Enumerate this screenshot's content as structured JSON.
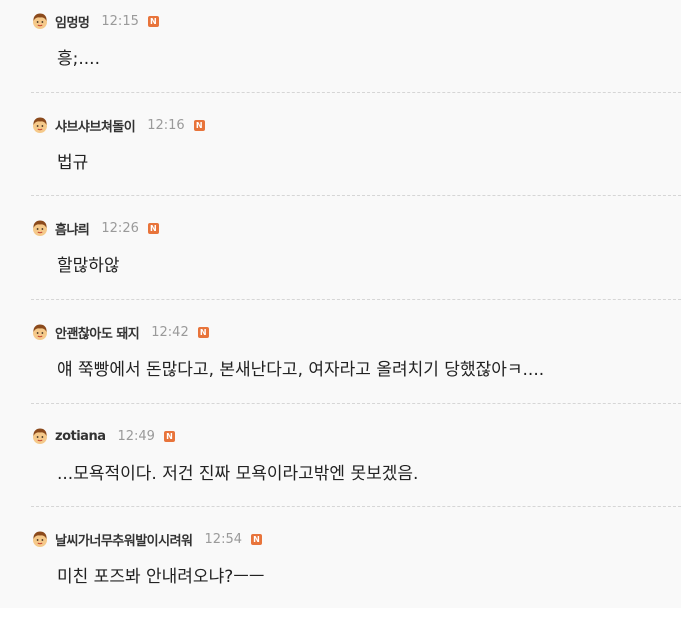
{
  "comments": [
    {
      "nickname": "임멍멍",
      "time": "12:15",
      "badge": "N",
      "text": "흥;...."
    },
    {
      "nickname": "샤브샤브쳐돌이",
      "time": "12:16",
      "badge": "N",
      "text": "법규"
    },
    {
      "nickname": "흠냐릐",
      "time": "12:26",
      "badge": "N",
      "text": "할많하않"
    },
    {
      "nickname": "안괜찮아도 돼지",
      "time": "12:42",
      "badge": "N",
      "text": "얘 쭉빵에서 돈많다고, 본새난다고, 여자라고 올려치기 당했잖아ㅋ...."
    },
    {
      "nickname": "zotiana",
      "time": "12:49",
      "badge": "N",
      "text": "...모욕적이다. 저건 진짜 모욕이라고밖엔 못보겠음."
    },
    {
      "nickname": "날씨가너무추워발이시려워",
      "time": "12:54",
      "badge": "N",
      "text": "미친 포즈봐 안내려오냐?ㅡㅡ"
    }
  ],
  "colors": {
    "background": "#f9f9f9",
    "nickname": "#333333",
    "time": "#9a9a9a",
    "badge": "#e8743b",
    "text": "#222222",
    "divider": "#d6d6d6"
  },
  "icons": {
    "avatar": "avatar-icon",
    "new_badge": "new-badge-icon"
  }
}
